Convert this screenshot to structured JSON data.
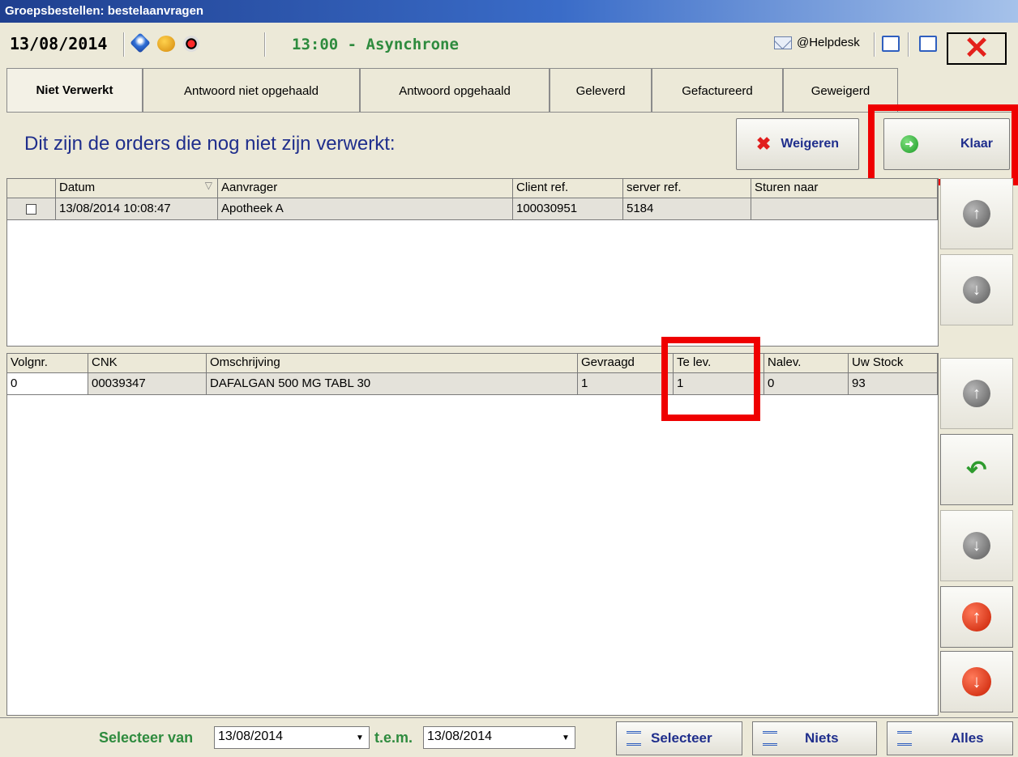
{
  "window": {
    "title": "Groepsbestellen: bestelaanvragen"
  },
  "toolbar": {
    "date": "13/08/2014",
    "status": "13:00 - Asynchrone",
    "helpdesk": "@Helpdesk",
    "icons": [
      "info-icon",
      "users-icon",
      "record-icon",
      "envelope-icon",
      "window-icon",
      "window-icon",
      "close-icon"
    ]
  },
  "tabs": [
    {
      "label": "Niet Verwerkt",
      "active": true
    },
    {
      "label": "Antwoord niet opgehaald",
      "active": false
    },
    {
      "label": "Antwoord opgehaald",
      "active": false
    },
    {
      "label": "Geleverd",
      "active": false
    },
    {
      "label": "Gefactureerd",
      "active": false
    },
    {
      "label": "Geweigerd",
      "active": false
    }
  ],
  "main": {
    "headline": "Dit zijn de orders die nog niet zijn verwerkt:",
    "reject_label": "Weigeren",
    "done_label": "Klaar"
  },
  "orders": {
    "columns": [
      "",
      "Datum",
      "Aanvrager",
      "Client ref.",
      "server ref.",
      "Sturen naar"
    ],
    "rows": [
      {
        "checked": false,
        "datum": "13/08/2014 10:08:47",
        "aanvrager": "Apotheek A",
        "client_ref": "100030951",
        "server_ref": "5184",
        "sturen_naar": ""
      }
    ]
  },
  "lines": {
    "columns": [
      "Volgnr.",
      "CNK",
      "Omschrijving",
      "Gevraagd",
      "Te lev.",
      "Nalev.",
      "Uw Stock"
    ],
    "rows": [
      {
        "volgnr": "0",
        "cnk": "00039347",
        "omschrijving": "DAFALGAN 500 MG TABL 30",
        "gevraagd": "1",
        "te_lev": "1",
        "nalev": "0",
        "uw_stock": "93"
      }
    ]
  },
  "footer": {
    "select_from_label": "Selecteer van",
    "from_date": "13/08/2014",
    "to_label": "t.e.m.",
    "to_date": "13/08/2014",
    "select_label": "Selecteer",
    "none_label": "Niets",
    "all_label": "Alles"
  },
  "colors": {
    "accent_blue": "#1f2e8c",
    "status_green": "#2e8b3e",
    "highlight_red": "#ef0000"
  }
}
